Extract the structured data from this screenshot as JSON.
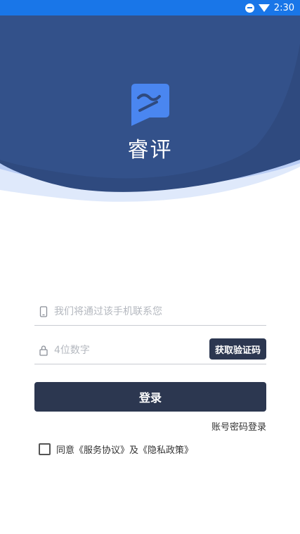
{
  "statusbar": {
    "time": "2:30"
  },
  "app": {
    "name": "睿评"
  },
  "form": {
    "phone_placeholder": "我们将通过该手机联系您",
    "code_placeholder": "4位数字",
    "get_code_label": "获取验证码",
    "login_label": "登录",
    "password_login_label": "账号密码登录"
  },
  "agreement": {
    "prefix": "同意",
    "service": "《服务协议》",
    "conjunction": "及",
    "privacy": "《隐私政策》",
    "checked": false
  },
  "colors": {
    "statusbar": "#1976e8",
    "hero_dark": "#2f4a7f",
    "hero_light": "#b9cdf5",
    "button": "#2c3750",
    "logo": "#4a86f0"
  }
}
